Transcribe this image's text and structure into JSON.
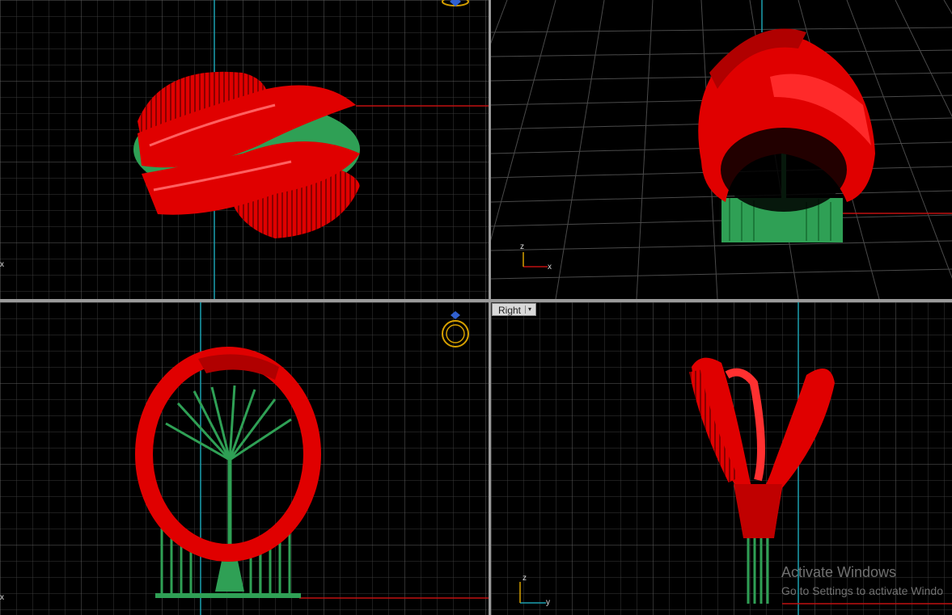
{
  "viewports": {
    "right": {
      "label": "Right"
    }
  },
  "axes": {
    "perspective": {
      "z": "z",
      "x": "x"
    },
    "right": {
      "z": "z",
      "y": "y"
    },
    "top": {
      "x": "x"
    },
    "front": {
      "x": "x"
    }
  },
  "watermark": {
    "title": "Activate Windows",
    "subtitle": "Go to Settings to activate Windo"
  },
  "colors": {
    "ring": "#e00000",
    "supports": "#2fa055",
    "grid_minor": "#3a3a3a",
    "grid_major": "#6a6a6a",
    "axis_red": "#c01010",
    "axis_cyan": "#1aa0b0"
  },
  "icons": {
    "ring_orientation": "ring-gizmo-icon"
  }
}
